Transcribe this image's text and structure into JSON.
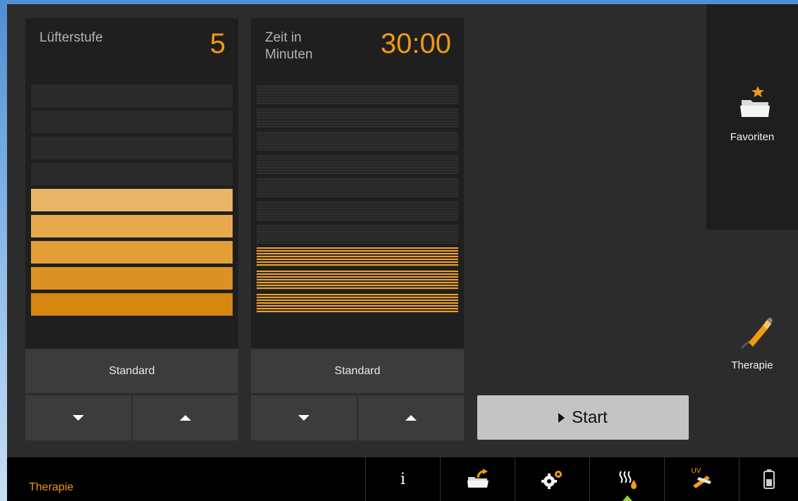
{
  "fan_panel": {
    "label": "Lüfterstufe",
    "value": "5",
    "level": 5,
    "max_level": 10,
    "standard_label": "Standard"
  },
  "time_panel": {
    "label_line1": "Zeit in",
    "label_line2": "Minuten",
    "value": "30:00",
    "level": 3,
    "max_level": 10,
    "standard_label": "Standard"
  },
  "start_button": {
    "label": "Start"
  },
  "sidebar": {
    "favorites_label": "Favoriten",
    "therapy_label": "Therapie"
  },
  "bottom_bar": {
    "title": "Therapie",
    "info_symbol": "i",
    "uv_text": "UV"
  },
  "colors": {
    "accent": "#f29a12",
    "panel_bg": "#1f1f1f",
    "screen_bg": "#2c2c2c",
    "bar_off": "#2a2a2a",
    "start_bg": "#c4c4c4",
    "nav_indicator": "#9ccc3c"
  },
  "icons": {
    "favorites": "folder-star-icon",
    "therapy": "applicator-pen-icon",
    "info": "info-icon",
    "load": "folder-load-icon",
    "settings": "gear-icon",
    "heat": "heat-water-icon",
    "uv": "uv-applicator-icon",
    "battery": "battery-icon"
  }
}
